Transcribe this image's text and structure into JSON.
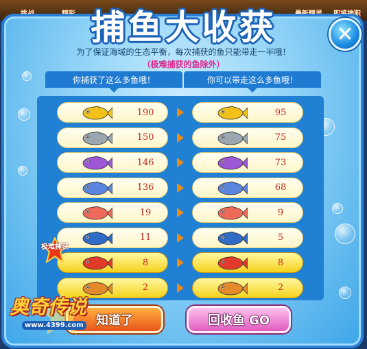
{
  "top_strip": {
    "items": [
      "挑战",
      "精彩",
      "最新精灵",
      "即将神职"
    ]
  },
  "title": "捕鱼大收获",
  "close_label": "✕",
  "info_line": "为了保证海域的生态平衡，每次捕获的鱼只能带走一半哦！",
  "info_note": "（极难捕获的鱼除外）",
  "headers": {
    "caught": "你捕获了这么多鱼哦！",
    "take": "你可以带走这么多鱼哦！"
  },
  "fish_rows": [
    {
      "icon": "gold-fish-icon",
      "color": "#f2c21a",
      "caught": "190",
      "take": "95",
      "rare": false
    },
    {
      "icon": "silver-fish-icon",
      "color": "#9aa6b0",
      "caught": "150",
      "take": "75",
      "rare": false
    },
    {
      "icon": "purple-fish-icon",
      "color": "#9b57d6",
      "caught": "146",
      "take": "73",
      "rare": false
    },
    {
      "icon": "blue-fish-icon",
      "color": "#5a86e0",
      "caught": "136",
      "take": "68",
      "rare": false
    },
    {
      "icon": "red-fish-icon",
      "color": "#f06a5a",
      "caught": "19",
      "take": "9",
      "rare": false
    },
    {
      "icon": "bluewhite-fish-icon",
      "color": "#2f6cc6",
      "caught": "11",
      "take": "5",
      "rare": false
    },
    {
      "icon": "redgold-fish-icon",
      "color": "#e23a2a",
      "caught": "8",
      "take": "8",
      "rare": true
    },
    {
      "icon": "crab-fish-icon",
      "color": "#e48a2a",
      "caught": "2",
      "take": "2",
      "rare": true
    }
  ],
  "rare_badge": "极难捕获",
  "buttons": {
    "know": "知道了",
    "recycle": "回收鱼 GO"
  },
  "logo": {
    "text": "奥奇传说",
    "url": "www.4399.com"
  }
}
